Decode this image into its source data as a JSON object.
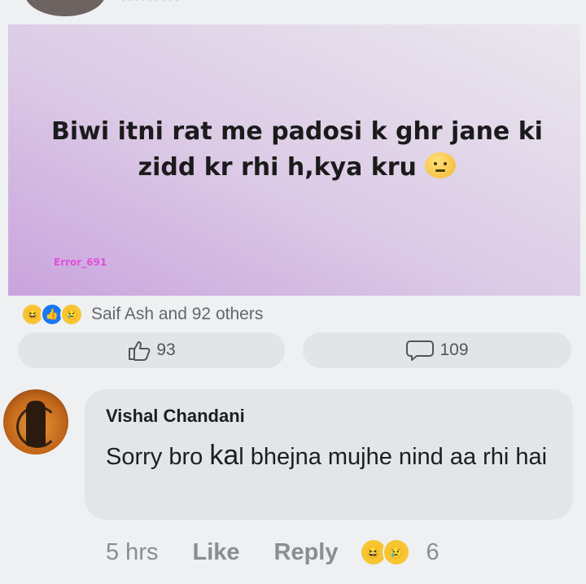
{
  "post": {
    "text": "Biwi itni rat me padosi k ghr jane ki zidd kr rhi h,kya kru",
    "watermark": "Error_691"
  },
  "reactions": {
    "icons": [
      "haha-icon",
      "like-icon",
      "sad-icon"
    ],
    "summary": "Saif Ash and 92 others"
  },
  "actions": {
    "like_count": "93",
    "comment_count": "109"
  },
  "comment": {
    "author": "Vishal Chandani",
    "text_before": "Sorry bro ",
    "text_big": "ka",
    "text_after": "l bhejna mujhe nind aa rhi hai",
    "time": "5 hrs",
    "like_label": "Like",
    "reply_label": "Reply",
    "reaction_count": "6"
  },
  "colors": {
    "accent": "#1877f2",
    "reaction_yellow": "#f7c531",
    "watermark": "#e04fd9"
  }
}
